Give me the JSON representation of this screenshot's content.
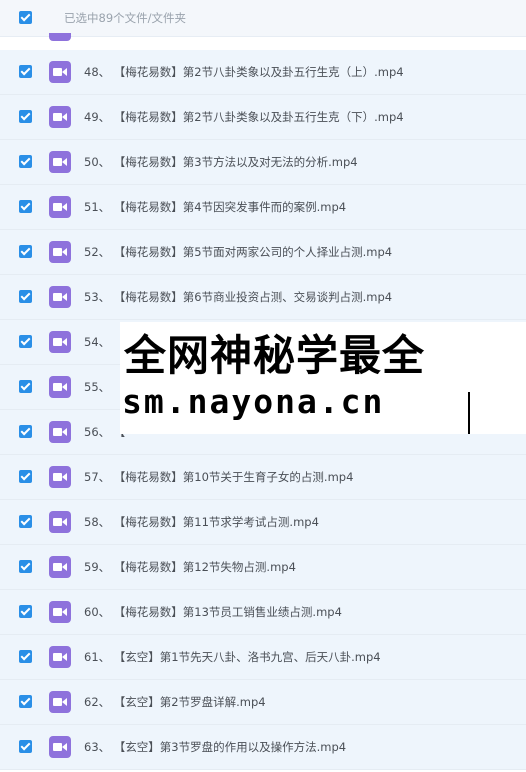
{
  "header": {
    "selection_text": "已选中89个文件/文件夹"
  },
  "icons": {
    "row_icon": "video-file-icon",
    "checkbox": "checkbox-checked-icon"
  },
  "colors": {
    "checkbox": "#2a8fe7",
    "video_icon": "#8e72dc",
    "selected_row_bg": "#eef5fc"
  },
  "files": [
    {
      "index": "48",
      "name": "【梅花易数】第2节八卦类象以及卦五行生克（上）.mp4"
    },
    {
      "index": "49",
      "name": "【梅花易数】第2节八卦类象以及卦五行生克（下）.mp4"
    },
    {
      "index": "50",
      "name": "【梅花易数】第3节方法以及对无法的分析.mp4"
    },
    {
      "index": "51",
      "name": "【梅花易数】第4节因突发事件而的案例.mp4"
    },
    {
      "index": "52",
      "name": "【梅花易数】第5节面对两家公司的个人择业占测.mp4"
    },
    {
      "index": "53",
      "name": "【梅花易数】第6节商业投资占测、交易谈判占测.mp4"
    },
    {
      "index": "54",
      "name": "【"
    },
    {
      "index": "55",
      "name": "【"
    },
    {
      "index": "56",
      "name": "【"
    },
    {
      "index": "57",
      "name": "【梅花易数】第10节关于生育子女的占测.mp4"
    },
    {
      "index": "58",
      "name": "【梅花易数】第11节求学考试占测.mp4"
    },
    {
      "index": "59",
      "name": "【梅花易数】第12节失物占测.mp4"
    },
    {
      "index": "60",
      "name": "【梅花易数】第13节员工销售业绩占测.mp4"
    },
    {
      "index": "61",
      "name": "【玄空】第1节先天八卦、洛书九宫、后天八卦.mp4"
    },
    {
      "index": "62",
      "name": "【玄空】第2节罗盘详解.mp4"
    },
    {
      "index": "63",
      "name": "【玄空】第3节罗盘的作用以及操作方法.mp4"
    }
  ],
  "watermark": {
    "line1": "全网神秘学最全",
    "line2": "sm.nayona.cn"
  }
}
